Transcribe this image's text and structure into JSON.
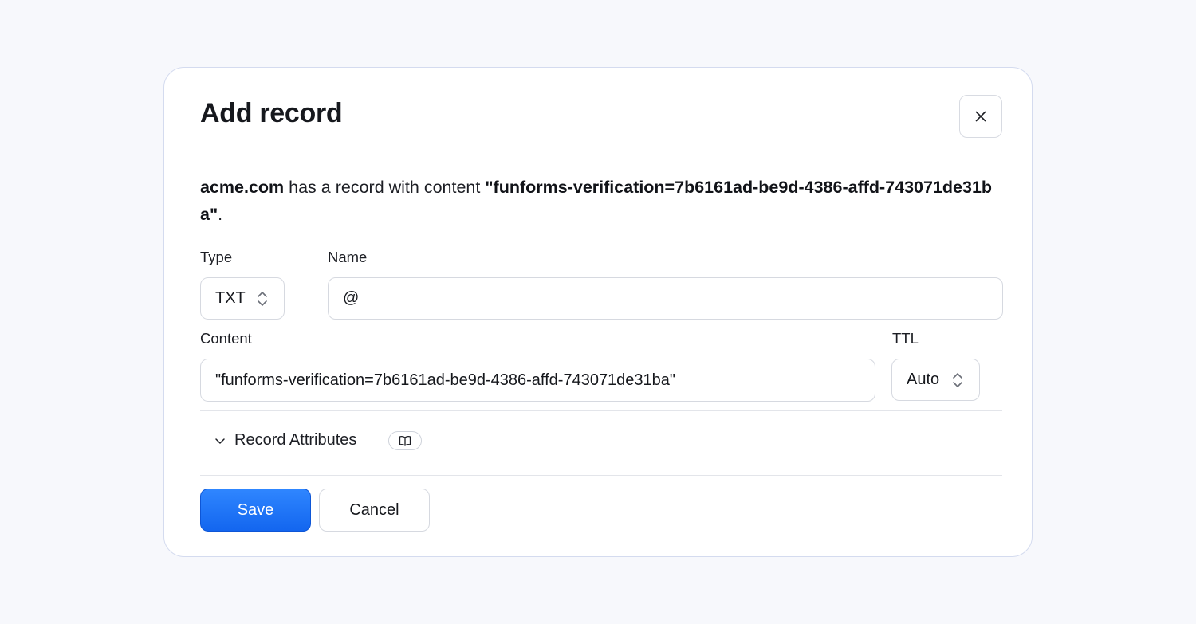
{
  "dialog": {
    "title": "Add record",
    "close_icon": "close-icon"
  },
  "description": {
    "domain": "acme.com",
    "middle_text": " has a record with content ",
    "content": "\"funforms-verification=7b6161ad-be9d-4386-affd-743071de31ba\"",
    "end_text": "."
  },
  "form": {
    "type_label": "Type",
    "type_value": "TXT",
    "name_label": "Name",
    "name_value": "@",
    "content_label": "Content",
    "content_value": "\"funforms-verification=7b6161ad-be9d-4386-affd-743071de31ba\"",
    "ttl_label": "TTL",
    "ttl_value": "Auto"
  },
  "attributes": {
    "label": "Record Attributes",
    "toggle_icon": "chevron-down-icon",
    "docs_icon": "book-icon"
  },
  "actions": {
    "save_label": "Save",
    "cancel_label": "Cancel"
  },
  "colors": {
    "accent": "#1a73ff",
    "background": "#f7f8fc",
    "border": "#d6d9e0"
  }
}
